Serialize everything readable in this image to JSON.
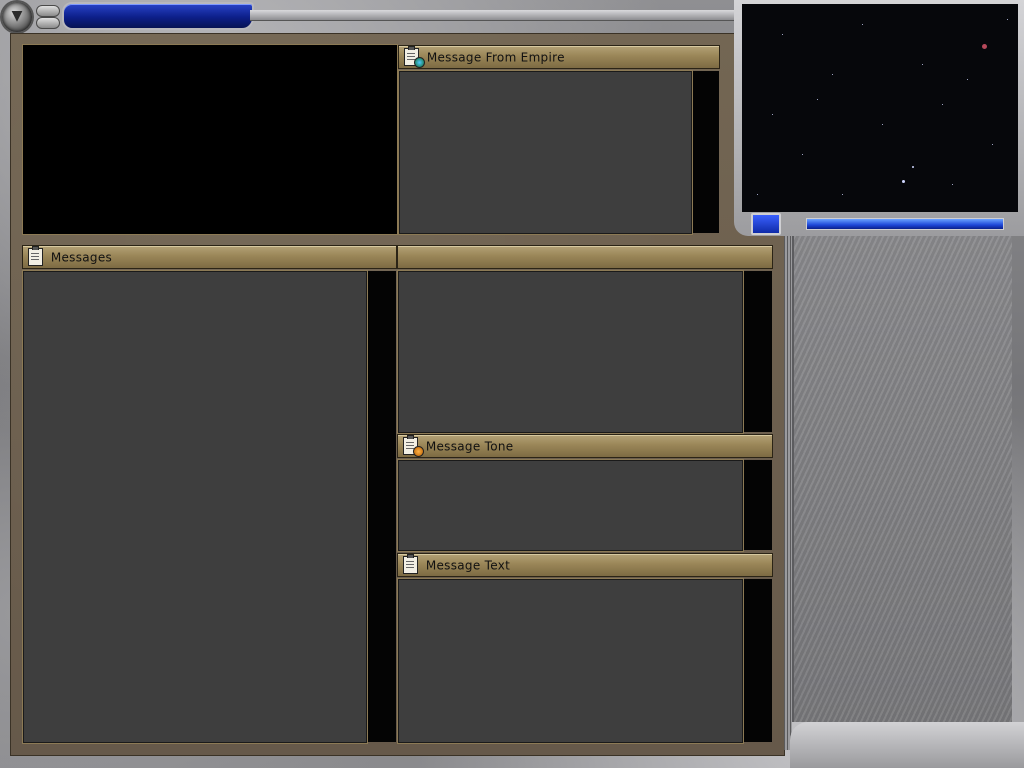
{
  "panels": {
    "empire": {
      "title": "Message From Empire"
    },
    "messages": {
      "title": "Messages"
    },
    "details": {
      "title": ""
    },
    "tone": {
      "title": "Message Tone"
    },
    "text": {
      "title": "Message Text"
    }
  },
  "colors": {
    "panel_brown": "#6b5f4f",
    "pane_gray": "#3e3e3e",
    "header_gold": "#9a8658",
    "accent_blue": "#1d46d8"
  },
  "icons": {
    "corner_knob": "menu-icon",
    "headers": "clipboard-icon"
  }
}
